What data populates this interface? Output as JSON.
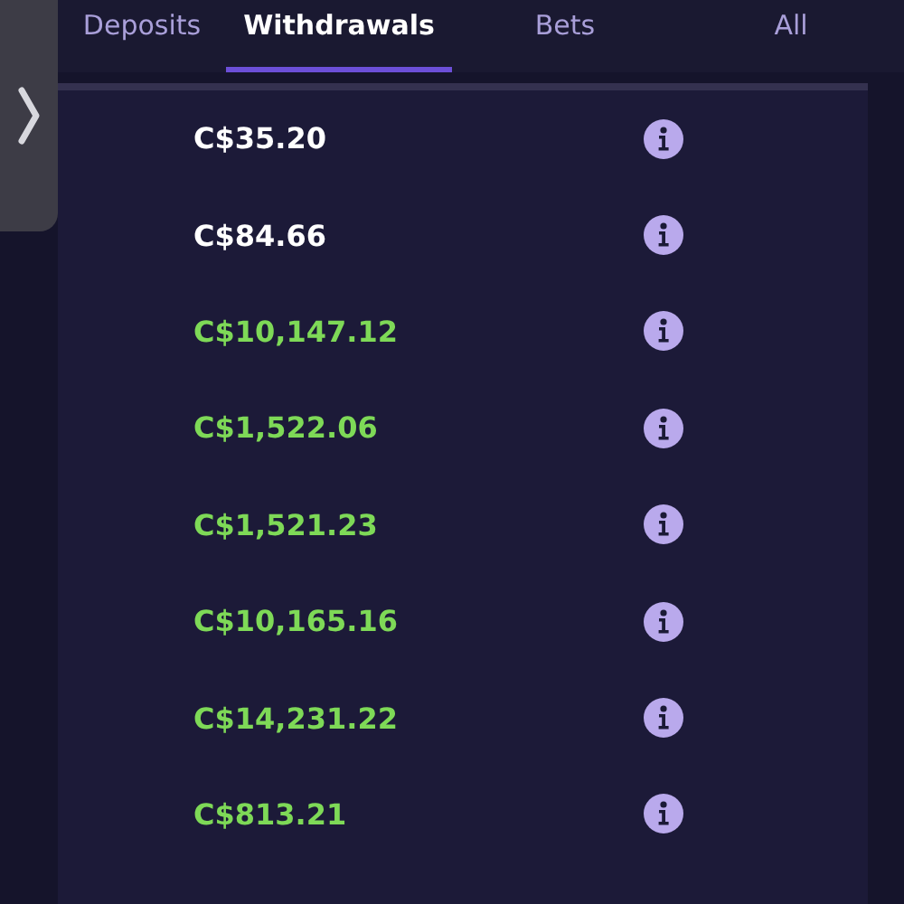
{
  "tabs": [
    {
      "label": "Deposits",
      "selected": false
    },
    {
      "label": "Withdrawals",
      "selected": true
    },
    {
      "label": "Bets",
      "selected": false
    },
    {
      "label": "All",
      "selected": false
    }
  ],
  "transactions": [
    {
      "amount": "C$35.20",
      "color": "#ffffff"
    },
    {
      "amount": "C$84.66",
      "color": "#ffffff"
    },
    {
      "amount": "C$10,147.12",
      "color": "#7ed957"
    },
    {
      "amount": "C$1,522.06",
      "color": "#7ed957"
    },
    {
      "amount": "C$1,521.23",
      "color": "#7ed957"
    },
    {
      "amount": "C$10,165.16",
      "color": "#7ed957"
    },
    {
      "amount": "C$14,231.22",
      "color": "#7ed957"
    },
    {
      "amount": "C$813.21",
      "color": "#7ed957"
    }
  ]
}
